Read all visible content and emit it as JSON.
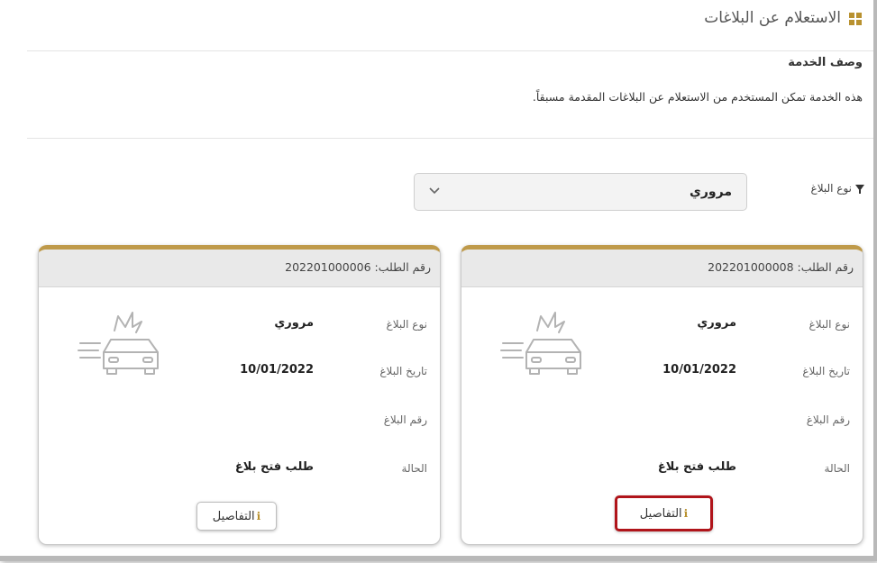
{
  "page": {
    "title": "الاستعلام عن البلاغات",
    "description_heading": "وصف الخدمة",
    "description_text": "هذه الخدمة تمكن المستخدم من الاستعلام عن البلاغات المقدمة مسبقاً."
  },
  "filter": {
    "label": "نوع البلاغ",
    "selected": "مروري"
  },
  "cards": [
    {
      "request": "رقم الطلب: 202201000008",
      "type_label": "نوع البلاغ",
      "type_value": "مروري",
      "date_label": "تاريخ البلاغ",
      "date_value": "10/01/2022",
      "number_label": "رقم البلاغ",
      "number_value": "",
      "status_label": "الحالة",
      "status_value": "طلب فتح بلاغ",
      "details_label": "التفاصيل",
      "highlighted": true
    },
    {
      "request": "رقم الطلب: 202201000006",
      "type_label": "نوع البلاغ",
      "type_value": "مروري",
      "date_label": "تاريخ البلاغ",
      "date_value": "10/01/2022",
      "number_label": "رقم البلاغ",
      "number_value": "",
      "status_label": "الحالة",
      "status_value": "طلب فتح بلاغ",
      "details_label": "التفاصيل",
      "highlighted": false
    }
  ],
  "colors": {
    "accent": "#bf9a4a",
    "highlight": "#b0141a"
  },
  "icons": [
    "grid-icon",
    "filter-icon",
    "chevron-down-icon",
    "car-crash-icon",
    "info-icon"
  ]
}
